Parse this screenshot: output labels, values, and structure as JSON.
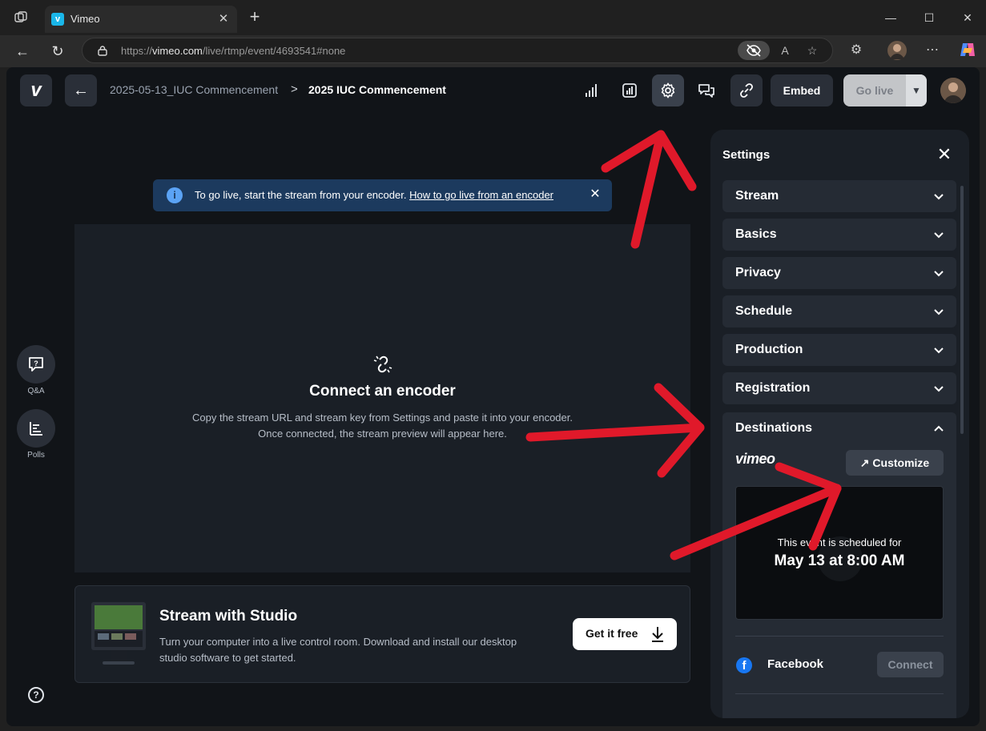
{
  "browser": {
    "tab_title": "Vimeo",
    "tab_favicon_letter": "v",
    "url_prefix": "https://",
    "url_host": "vimeo.com",
    "url_path": "/live/rtmp/event/4693541#none"
  },
  "header": {
    "logo_letter": "v",
    "breadcrumb_parent": "2025-05-13_IUC Commencement",
    "breadcrumb_separator": ">",
    "breadcrumb_current": "2025 IUC Commencement",
    "embed_label": "Embed",
    "golive_label": "Go live"
  },
  "banner": {
    "text": "To go live, start the stream from your encoder.",
    "link": "How to go live from an encoder"
  },
  "preview": {
    "title": "Connect an encoder",
    "line1": "Copy the stream URL and stream key from Settings and paste it into your encoder.",
    "line2": "Once connected, the stream preview will appear here."
  },
  "studio": {
    "title": "Stream with Studio",
    "desc_line1": "Turn your computer into a live control room. Download and install our desktop",
    "desc_line2": "studio software to get started.",
    "button_label": "Get it free"
  },
  "rail": {
    "qa_label": "Q&A",
    "polls_label": "Polls",
    "help_glyph": "?"
  },
  "settings": {
    "title": "Settings",
    "sections": [
      "Stream",
      "Basics",
      "Privacy",
      "Schedule",
      "Production",
      "Registration"
    ],
    "destinations_label": "Destinations",
    "vimeo_wordmark": "vimeo",
    "customize_label": "Customize",
    "schedule_small": "This event is scheduled for",
    "schedule_big": "May 13 at 8:00 AM",
    "facebook_label": "Facebook",
    "connect_label": "Connect"
  },
  "colors": {
    "app_bg": "#111418",
    "panel_bg": "#1a1f26",
    "accordion_bg": "#252b34",
    "banner_bg": "#1c3a5e",
    "annotation_arrow": "#e0192a",
    "facebook_blue": "#1877f2"
  }
}
